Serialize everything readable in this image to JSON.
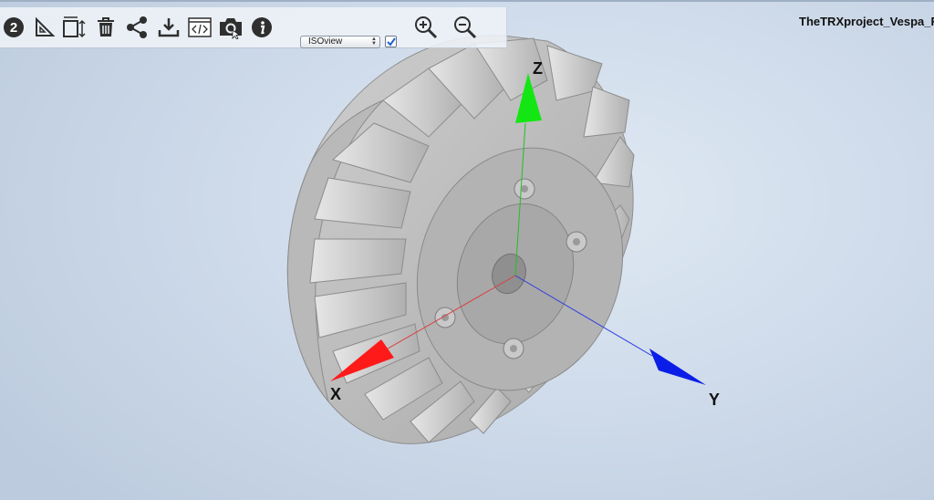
{
  "window": {
    "title": "TheTRXproject_Vespa_Fl"
  },
  "toolbar": {
    "badge_number": "2",
    "buttons": [
      {
        "name": "measure-icon"
      },
      {
        "name": "dimension-icon"
      },
      {
        "name": "trash-icon"
      },
      {
        "name": "share-icon"
      },
      {
        "name": "download-icon"
      },
      {
        "name": "embed-code-icon"
      },
      {
        "name": "camera-icon"
      },
      {
        "name": "info-icon"
      }
    ],
    "view_select": {
      "selected": "ISOview"
    },
    "view_checkbox": {
      "checked": true
    },
    "zoom_in": "zoom-in-icon",
    "zoom_out": "zoom-out-icon"
  },
  "viewport": {
    "axes": {
      "x_label": "X",
      "y_label": "Y",
      "z_label": "Z"
    },
    "colors": {
      "x_axis": "#ff1a1a",
      "y_axis": "#0a1ee8",
      "z_axis": "#14e614",
      "model": "#c4c4c4",
      "background": "#d5e0ec"
    }
  }
}
